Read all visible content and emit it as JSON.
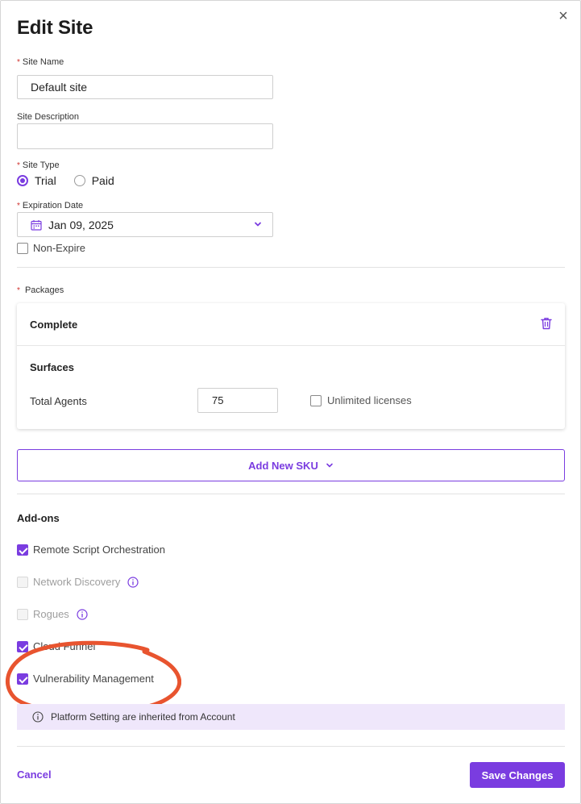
{
  "dialog": {
    "title": "Edit Site",
    "close_glyph": "×"
  },
  "required_marker": "*",
  "site_name": {
    "label": "Site Name",
    "value": "Default site"
  },
  "site_description": {
    "label": "Site Description",
    "value": ""
  },
  "site_type": {
    "label": "Site Type",
    "options": [
      {
        "label": "Trial",
        "selected": true
      },
      {
        "label": "Paid",
        "selected": false
      }
    ]
  },
  "expiration": {
    "label": "Expiration Date",
    "value": "Jan 09, 2025",
    "non_expire_label": "Non-Expire",
    "non_expire_checked": false
  },
  "packages": {
    "label": "Packages",
    "card_title": "Complete",
    "section": "Surfaces",
    "total_agents_label": "Total Agents",
    "total_agents_value": "75",
    "unlimited_label": "Unlimited licenses"
  },
  "add_sku_label": "Add New SKU",
  "addons": {
    "title": "Add-ons",
    "items": [
      {
        "label": "Remote Script Orchestration",
        "checked": true,
        "disabled": false,
        "info": false
      },
      {
        "label": "Network Discovery",
        "checked": false,
        "disabled": true,
        "info": true
      },
      {
        "label": "Rogues",
        "checked": false,
        "disabled": true,
        "info": true
      },
      {
        "label": "Cloud Funnel",
        "checked": true,
        "disabled": false,
        "info": false
      },
      {
        "label": "Vulnerability Management",
        "checked": true,
        "disabled": false,
        "info": false
      }
    ]
  },
  "notice": "Platform Setting are inherited from Account",
  "footer": {
    "cancel_label": "Cancel",
    "save_label": "Save Changes"
  },
  "colors": {
    "accent": "#7a3ce0",
    "required": "#d0312d",
    "notice_bg": "#efe7fb",
    "annotation": "#e8542f"
  }
}
